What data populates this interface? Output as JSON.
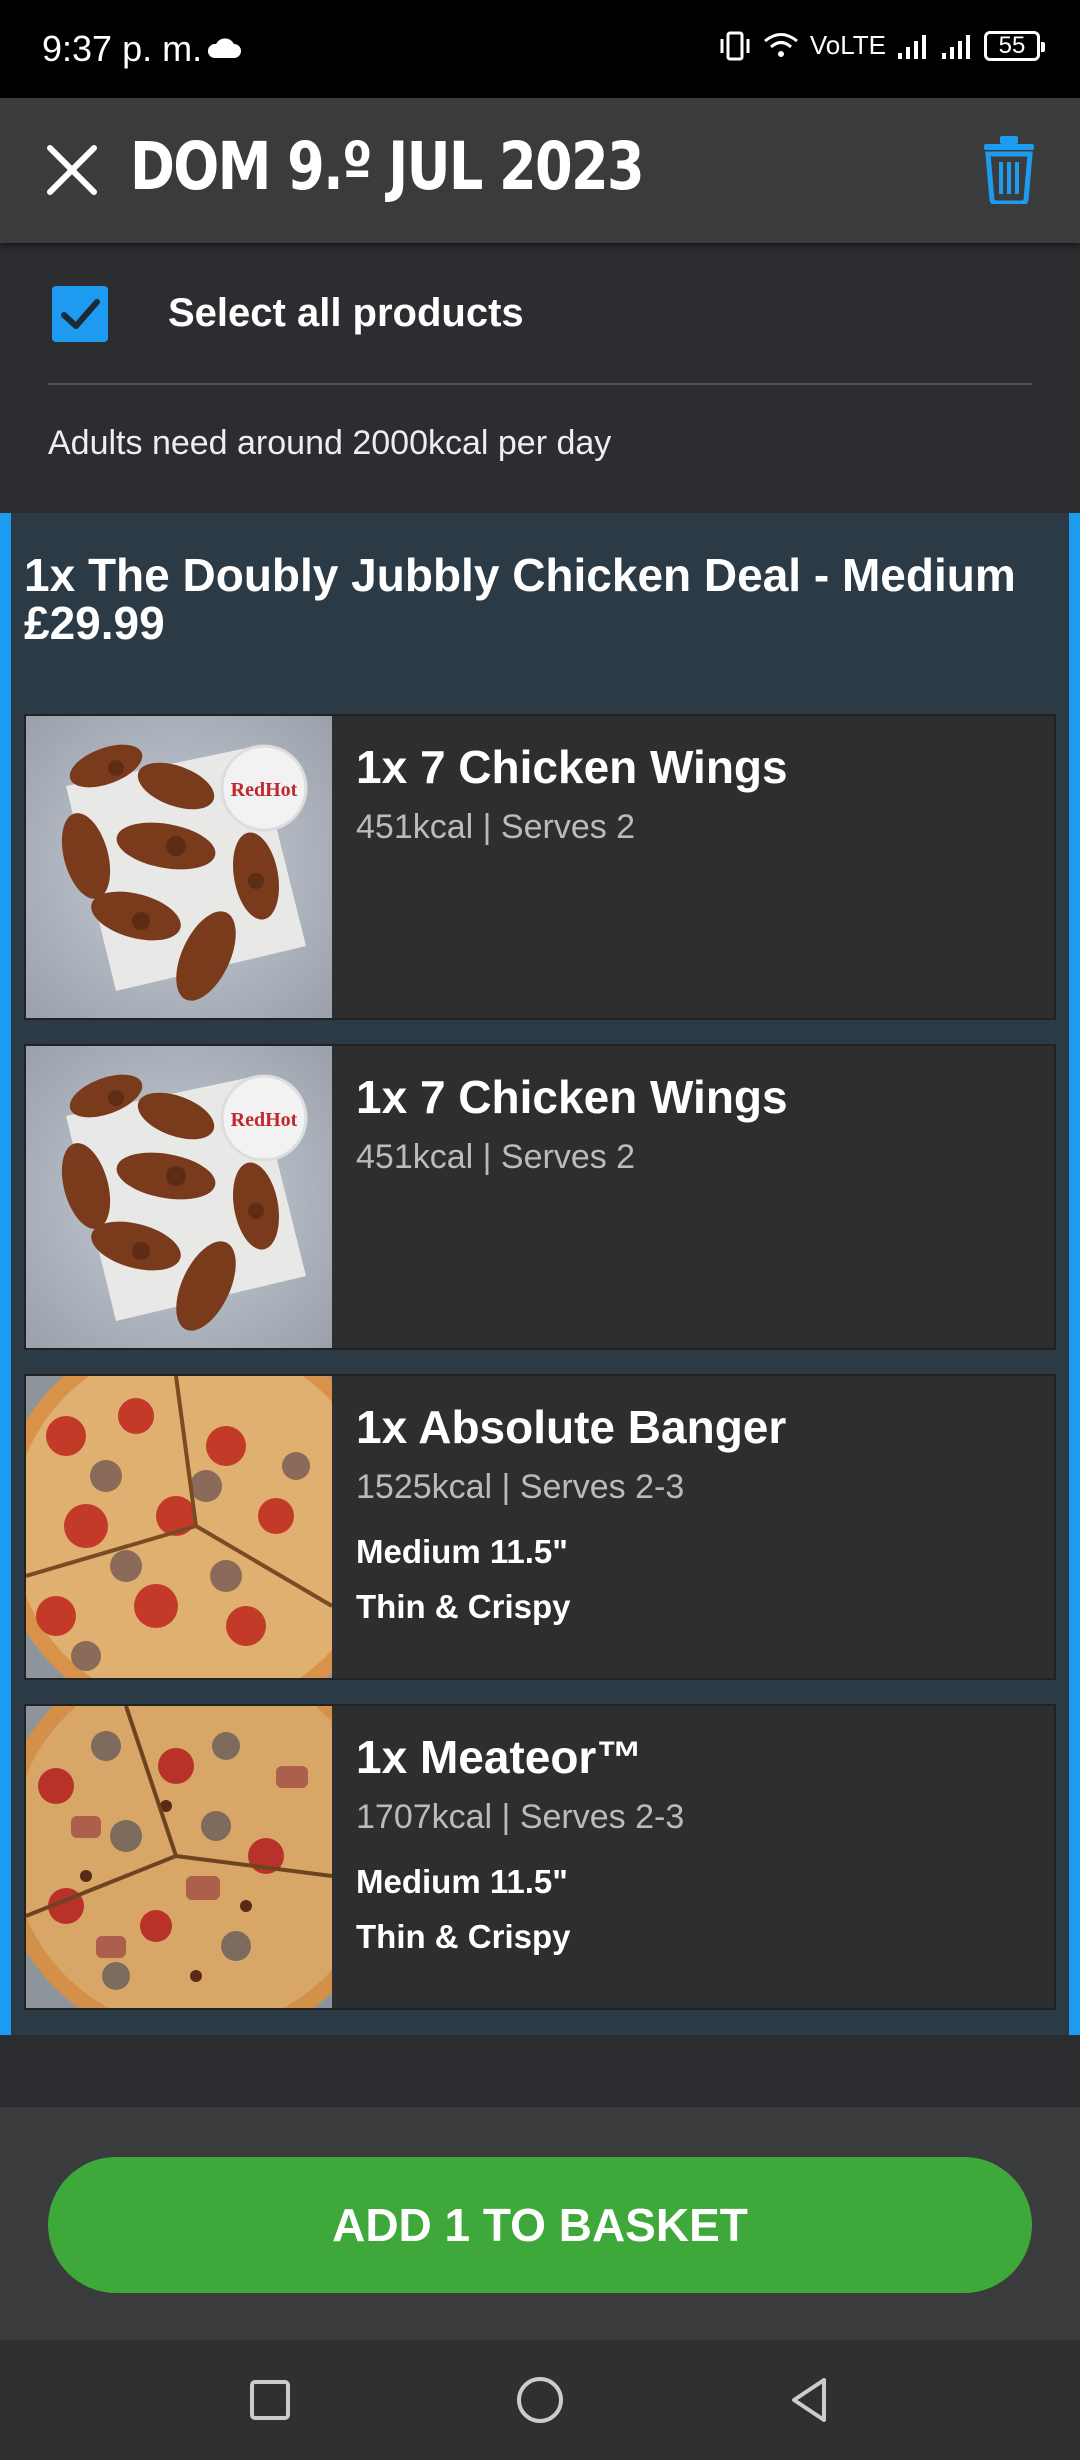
{
  "status_bar": {
    "time": "9:37 p. m.",
    "network": "VoLTE",
    "battery": "55"
  },
  "header": {
    "title": "DOM 9.º JUL 2023"
  },
  "select_all": {
    "label": "Select all products",
    "checked": true
  },
  "kcal_note": "Adults need around 2000kcal per day",
  "deal": {
    "title": "1x The Doubly Jubbly Chicken Deal - Medium",
    "price": "£29.99",
    "items": [
      {
        "name": "1x 7 Chicken Wings",
        "meta": "451kcal | Serves 2",
        "image": "chicken-wings-image"
      },
      {
        "name": "1x 7 Chicken Wings",
        "meta": "451kcal | Serves 2",
        "image": "chicken-wings-image"
      },
      {
        "name": "1x Absolute Banger",
        "meta": "1525kcal | Serves 2-3",
        "size": "Medium 11.5\"",
        "crust": "Thin & Crispy",
        "image": "pizza-image"
      },
      {
        "name": "1x Meateor™",
        "meta": "1707kcal | Serves 2-3",
        "size": "Medium 11.5\"",
        "crust": "Thin & Crispy",
        "image": "pizza-image"
      }
    ]
  },
  "basket_button": {
    "label": "ADD 1 TO BASKET"
  },
  "colors": {
    "accent": "#1d9bf0",
    "button_green": "#3ea83a"
  }
}
